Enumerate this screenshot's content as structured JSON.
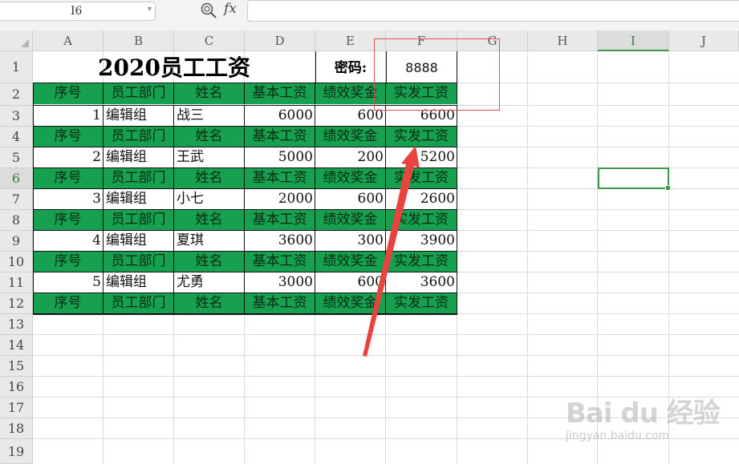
{
  "formula_bar": {
    "name_box": "I6",
    "fx_label": "fx",
    "formula": ""
  },
  "columns": [
    "A",
    "B",
    "C",
    "D",
    "E",
    "F",
    "G",
    "H",
    "I",
    "J"
  ],
  "selected_column": "I",
  "rows": [
    "1",
    "2",
    "3",
    "4",
    "5",
    "6",
    "7",
    "8",
    "9",
    "10",
    "11",
    "12",
    "13",
    "14",
    "15",
    "16",
    "17",
    "18",
    "19"
  ],
  "selected_row": "6",
  "sheet": {
    "title": "2020员工工资",
    "password_label": "密码:",
    "password_value": "8888",
    "header": [
      "序号",
      "员工部门",
      "姓名",
      "基本工资",
      "绩效奖金",
      "实发工资"
    ],
    "records": [
      {
        "no": "1",
        "dept": "编辑组",
        "name": "战三",
        "base": "6000",
        "bonus": "600",
        "total": "6600"
      },
      {
        "no": "2",
        "dept": "编辑组",
        "name": "王武",
        "base": "5000",
        "bonus": "200",
        "total": "5200"
      },
      {
        "no": "3",
        "dept": "编辑组",
        "name": "小七",
        "base": "2000",
        "bonus": "600",
        "total": "2600"
      },
      {
        "no": "4",
        "dept": "编辑组",
        "name": "夏琪",
        "base": "3600",
        "bonus": "300",
        "total": "3900"
      },
      {
        "no": "5",
        "dept": "编辑组",
        "name": "尤勇",
        "base": "3000",
        "bonus": "600",
        "total": "3600"
      }
    ]
  },
  "colors": {
    "header_fill": "#17a050",
    "selection": "#3a9a4a",
    "annotation": "#e8433f"
  },
  "watermark": {
    "brand": "Bai du 经验",
    "url": "jingyan.baidu.com"
  }
}
